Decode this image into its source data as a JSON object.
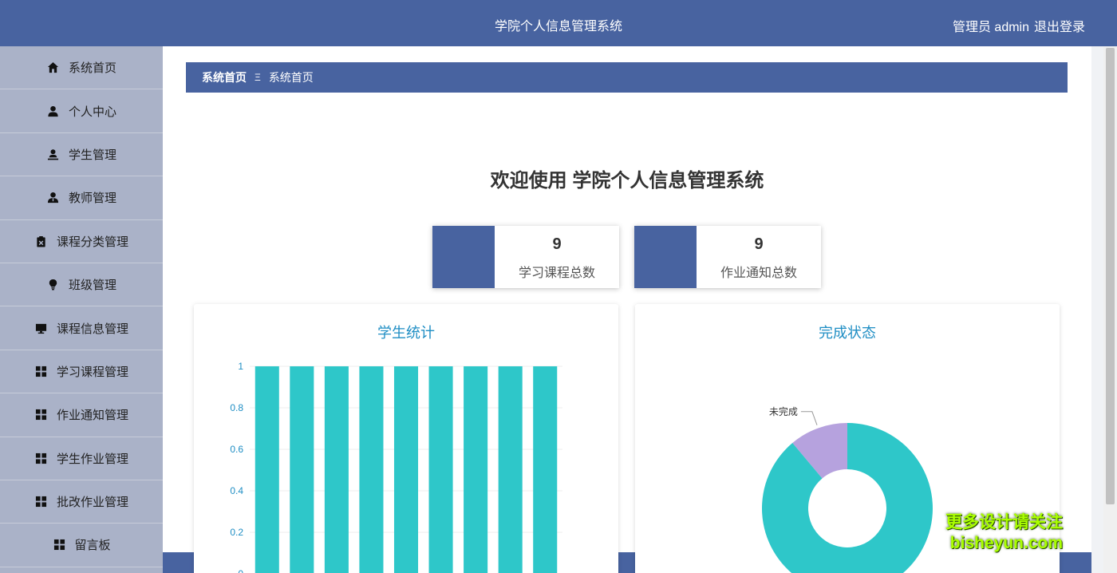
{
  "header": {
    "title": "学院个人信息管理系统",
    "user": "管理员 admin",
    "logout": "退出登录"
  },
  "sidebar": {
    "items": [
      {
        "label": "系统首页",
        "icon": "home-icon"
      },
      {
        "label": "个人中心",
        "icon": "user-icon"
      },
      {
        "label": "学生管理",
        "icon": "student-icon"
      },
      {
        "label": "教师管理",
        "icon": "teacher-icon"
      },
      {
        "label": "课程分类管理",
        "icon": "clipboard-icon"
      },
      {
        "label": "班级管理",
        "icon": "lightbulb-icon"
      },
      {
        "label": "课程信息管理",
        "icon": "monitor-icon"
      },
      {
        "label": "学习课程管理",
        "icon": "grid-icon"
      },
      {
        "label": "作业通知管理",
        "icon": "grid-icon"
      },
      {
        "label": "学生作业管理",
        "icon": "grid-icon"
      },
      {
        "label": "批改作业管理",
        "icon": "grid-icon"
      },
      {
        "label": "留言板",
        "icon": "grid-icon"
      }
    ]
  },
  "breadcrumb": {
    "root": "系统首页",
    "separator": "Ξ",
    "current": "系统首页"
  },
  "welcome": "欢迎使用 学院个人信息管理系统",
  "stats": [
    {
      "value": "9",
      "label": "学习课程总数"
    },
    {
      "value": "9",
      "label": "作业通知总数"
    }
  ],
  "charts": {
    "left_title": "学生统计",
    "right_title": "完成状态"
  },
  "chart_data": [
    {
      "type": "bar",
      "title": "学生统计",
      "categories": [
        "",
        "",
        "",
        "",
        "",
        "",
        "",
        "",
        ""
      ],
      "values": [
        1,
        1,
        1,
        1,
        1,
        1,
        1,
        1,
        1
      ],
      "ylim": [
        0,
        1
      ],
      "yticks": [
        "0",
        "0.2",
        "0.4",
        "0.6",
        "0.8",
        "1"
      ],
      "color": "#2ec7c9"
    },
    {
      "type": "pie",
      "title": "完成状态",
      "slices": [
        {
          "name": "未完成",
          "value": 1,
          "color": "#b6a2de"
        },
        {
          "name": "",
          "value": 8,
          "color": "#2ec7c9"
        }
      ]
    }
  ],
  "watermark": {
    "line1": "更多设计请关注",
    "line2": "bisheyun.com"
  },
  "colors": {
    "primary": "#4863a0",
    "sidebar": "#aab2c8",
    "teal": "#2ec7c9",
    "purple": "#b6a2de",
    "title_blue": "#1f8ec4"
  }
}
